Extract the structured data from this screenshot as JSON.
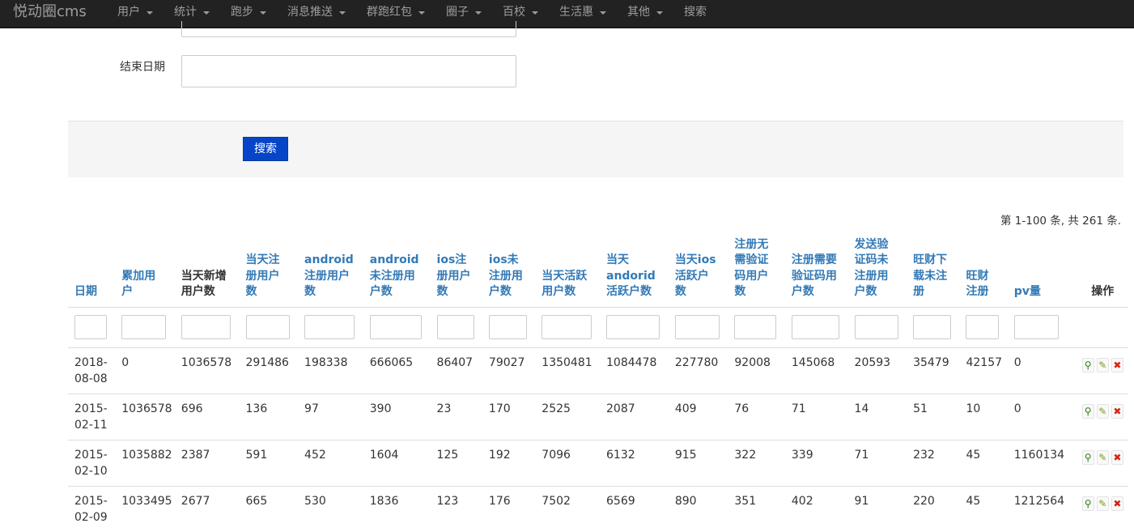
{
  "navbar": {
    "brand": "悦动圈cms",
    "items": [
      {
        "label": "用户",
        "dropdown": true
      },
      {
        "label": "统计",
        "dropdown": true
      },
      {
        "label": "跑步",
        "dropdown": true
      },
      {
        "label": "消息推送",
        "dropdown": true
      },
      {
        "label": "群跑红包",
        "dropdown": true
      },
      {
        "label": "圈子",
        "dropdown": true
      },
      {
        "label": "百校",
        "dropdown": true
      },
      {
        "label": "生活惠",
        "dropdown": true
      },
      {
        "label": "其他",
        "dropdown": true
      },
      {
        "label": "搜索",
        "dropdown": false
      }
    ]
  },
  "form": {
    "end_date_label": "结束日期",
    "end_date_value": "",
    "search_button": "搜索"
  },
  "summary": "第 1-100 条, 共 261 条.",
  "table": {
    "columns": [
      {
        "key": "date",
        "lines": [
          "日期"
        ],
        "link": true
      },
      {
        "key": "total",
        "lines": [
          "累加用",
          "户"
        ],
        "link": true
      },
      {
        "key": "new",
        "lines": [
          "当天新增",
          "用户数"
        ],
        "link": false
      },
      {
        "key": "reg",
        "lines": [
          "当天注",
          "册用户",
          "数"
        ],
        "link": true
      },
      {
        "key": "and_reg",
        "lines": [
          "android",
          "注册用户",
          "数"
        ],
        "link": true
      },
      {
        "key": "and_unreg",
        "lines": [
          "android",
          "未注册用",
          "户数"
        ],
        "link": true
      },
      {
        "key": "ios_reg",
        "lines": [
          "ios注",
          "册用户",
          "数"
        ],
        "link": true
      },
      {
        "key": "ios_unreg",
        "lines": [
          "ios未",
          "注册用",
          "户数"
        ],
        "link": true
      },
      {
        "key": "active",
        "lines": [
          "当天活跃",
          "用户数"
        ],
        "link": true
      },
      {
        "key": "and_active",
        "lines": [
          "当天",
          "andorid",
          "活跃户数"
        ],
        "link": true
      },
      {
        "key": "ios_active",
        "lines": [
          "当天ios",
          "活跃户",
          "数"
        ],
        "link": true
      },
      {
        "key": "no_code",
        "lines": [
          "注册无",
          "需验证",
          "码用户",
          "数"
        ],
        "link": true
      },
      {
        "key": "need_code",
        "lines": [
          "注册需要",
          "验证码用",
          "户数"
        ],
        "link": true
      },
      {
        "key": "code_unreg",
        "lines": [
          "发送验",
          "证码未",
          "注册用",
          "户数"
        ],
        "link": true
      },
      {
        "key": "wc_dl",
        "lines": [
          "旺财下",
          "载未注",
          "册"
        ],
        "link": true
      },
      {
        "key": "wc_reg",
        "lines": [
          "旺财",
          "注册"
        ],
        "link": true
      },
      {
        "key": "pv",
        "lines": [
          "pv量"
        ],
        "link": true
      },
      {
        "key": "ops",
        "lines": [
          "操作"
        ],
        "link": false
      }
    ],
    "rows": [
      {
        "date": [
          "2018-",
          "08-08"
        ],
        "values": [
          "0",
          "1036578",
          "291486",
          "198338",
          "666065",
          "86407",
          "79027",
          "1350481",
          "1084478",
          "227780",
          "92008",
          "145068",
          "20593",
          "35479",
          "42157",
          "0"
        ]
      },
      {
        "date": [
          "2015-",
          "02-11"
        ],
        "values": [
          "1036578",
          "696",
          "136",
          "97",
          "390",
          "23",
          "170",
          "2525",
          "2087",
          "409",
          "76",
          "71",
          "14",
          "51",
          "10",
          "0"
        ]
      },
      {
        "date": [
          "2015-",
          "02-10"
        ],
        "values": [
          "1035882",
          "2387",
          "591",
          "452",
          "1604",
          "125",
          "192",
          "7096",
          "6132",
          "915",
          "322",
          "339",
          "71",
          "232",
          "45",
          "1160134"
        ]
      },
      {
        "date": [
          "2015-",
          "02-09"
        ],
        "values": [
          "1033495",
          "2677",
          "665",
          "530",
          "1836",
          "123",
          "176",
          "7502",
          "6569",
          "890",
          "351",
          "402",
          "91",
          "220",
          "45",
          "1212564"
        ]
      }
    ],
    "action_icons": [
      "view-icon",
      "edit-icon",
      "delete-icon"
    ]
  },
  "colors": {
    "navbar_bg": "#222222",
    "link": "#337ab7",
    "button": "#0645c8",
    "delete": "#d9230f"
  }
}
